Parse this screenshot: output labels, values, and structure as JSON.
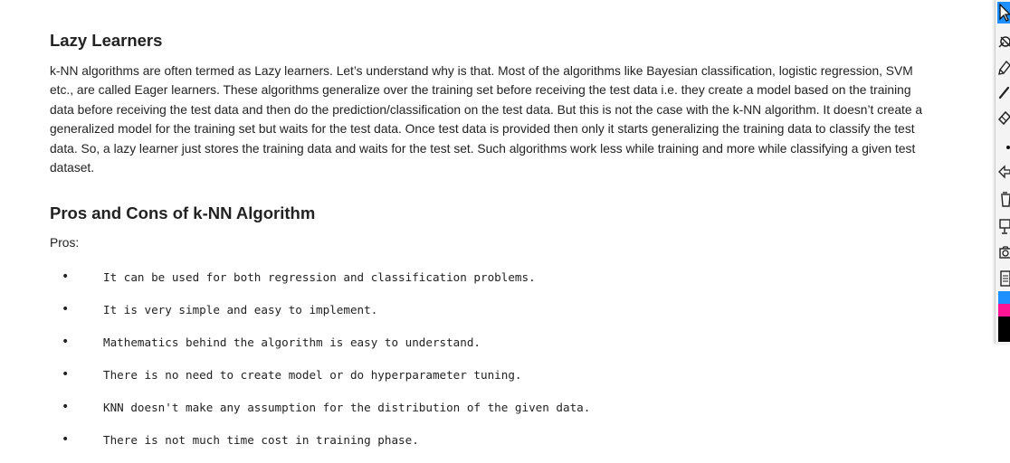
{
  "article": {
    "lazy_heading": "Lazy Learners",
    "lazy_paragraph_lines": [
      "k-NN algorithms are often termed as Lazy learners. Let’s understand why is that. Most of the algorithms like Bayesian classification, logistic regression, SVM",
      "etc., are called Eager learners. These algorithms generalize over the training set before receiving the test data i.e. they create a model based on the training",
      "data before receiving the test data and then do the prediction/classification on the test data. But this is not the case with the k-NN algorithm. It doesn’t create a",
      "generalized model for the training set but waits for the test data. Once test data is provided then only it starts generalizing the training data to classify the test",
      "data. So, a lazy learner just stores the training data and waits for the test set. Such algorithms work less while training and more while classifying a given test",
      "dataset."
    ],
    "pros_cons_heading": "Pros and Cons of k-NN Algorithm",
    "pros_label": "Pros:",
    "pros_items": [
      "It can be used for both regression and classification problems.",
      "It is very simple and easy to implement.",
      "Mathematics behind the algorithm is easy to understand.",
      "There is no need to create model or do hyperparameter tuning.",
      "KNN doesn't make any assumption for the distribution of the given data.",
      "There is not much time cost in training phase."
    ],
    "bullet": "•"
  },
  "toolbar": {
    "tools": [
      "cursor-icon",
      "eraser-icon",
      "highlighter-icon",
      "pen-icon",
      "marker-icon",
      "dot-icon",
      "arrow-icon",
      "trash-icon",
      "presentation-icon",
      "camera-icon",
      "notes-icon"
    ],
    "active_tool": "cursor-icon",
    "swatch_colors": [
      "#1e90ff",
      "#ff1493",
      "#000000"
    ]
  }
}
